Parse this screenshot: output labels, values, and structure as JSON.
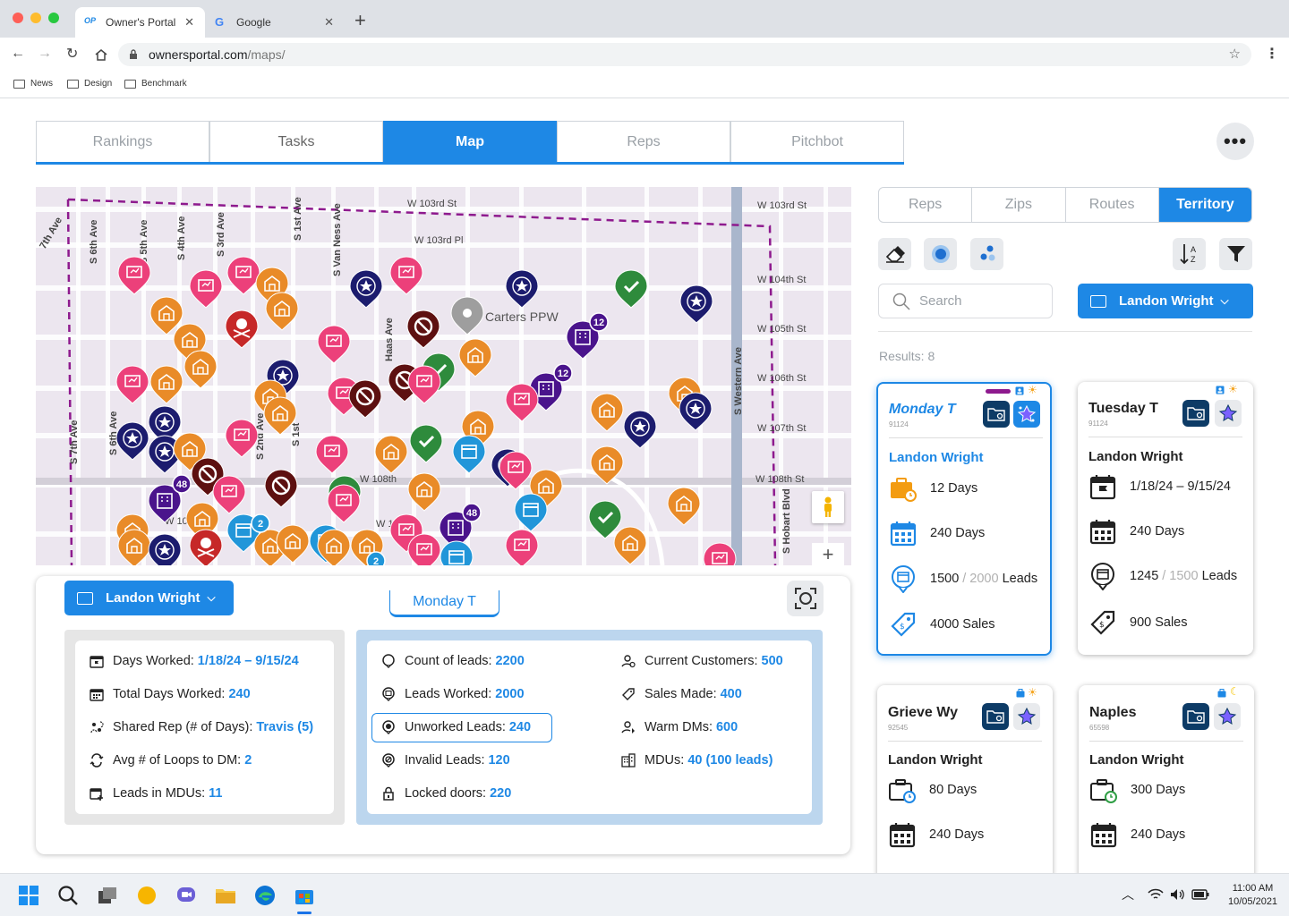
{
  "browser": {
    "tabs": [
      {
        "label": "Owner's Portal",
        "logo": "OP"
      },
      {
        "label": "Google",
        "logo": "G"
      }
    ],
    "url_domain": "ownersportal.com",
    "url_path": "/maps/",
    "bookmarks": [
      "News",
      "Design",
      "Benchmark"
    ]
  },
  "nav": {
    "tabs": [
      "Rankings",
      "Tasks",
      "Map",
      "Reps",
      "Pitchbot"
    ],
    "active": "Map"
  },
  "map": {
    "streets": [
      {
        "label": "W 103rd St"
      },
      {
        "label": "W 103rd Pl"
      },
      {
        "label": "W 103rd St"
      },
      {
        "label": "W 104th St"
      },
      {
        "label": "W 105th St"
      },
      {
        "label": "W 106th St"
      },
      {
        "label": "W 107th St"
      },
      {
        "label": "W 108th St"
      },
      {
        "label": "W 108th"
      },
      {
        "label": "W 109"
      },
      {
        "label": "W 109"
      },
      {
        "label": "S Van Ness Ave"
      },
      {
        "label": "S 1st Ave"
      },
      {
        "label": "S 3rd Ave"
      },
      {
        "label": "S 4th Ave"
      },
      {
        "label": "S 5th Ave"
      },
      {
        "label": "S 6th Ave"
      },
      {
        "label": "7th Ave"
      },
      {
        "label": "S Western Ave"
      },
      {
        "label": "Haas Ave"
      },
      {
        "label": "S Hobart Blvd"
      },
      {
        "label": "S 6th Ave"
      },
      {
        "label": "S 7th Ave"
      },
      {
        "label": "S 2nd Ave"
      },
      {
        "label": "S 1st"
      }
    ],
    "place_label": "Carters PPW",
    "cluster_counts": [
      "12",
      "12",
      "48",
      "48",
      "2",
      "2"
    ]
  },
  "bottom": {
    "rep_dropdown": "Landon Wright",
    "route_tab": "Monday T",
    "left_stats": [
      {
        "label": "Days Worked:",
        "value": "1/18/24 – 9/15/24",
        "icon": "calendar-flag-icon"
      },
      {
        "label": "Total Days Worked:",
        "value": "240",
        "icon": "calendar-icon"
      },
      {
        "label": "Shared Rep (# of Days):",
        "value": "Travis (5)",
        "icon": "shared-rep-icon"
      },
      {
        "label": "Avg # of Loops to DM:",
        "value": "2",
        "icon": "loop-icon"
      },
      {
        "label": "Leads in MDUs:",
        "value": "11",
        "icon": "calendar-add-icon"
      }
    ],
    "mid_stats_col1": [
      {
        "label": "Count of leads:",
        "value": "2200",
        "icon": "circle-icon"
      },
      {
        "label": "Leads Worked:",
        "value": "2000",
        "icon": "calendar-circle-icon"
      },
      {
        "label": "Unworked Leads:",
        "value": "240",
        "icon": "unworked-icon",
        "highlight": true
      },
      {
        "label": "Invalid Leads:",
        "value": "120",
        "icon": "invalid-icon"
      },
      {
        "label": "Locked doors:",
        "value": "220",
        "icon": "lock-icon"
      }
    ],
    "mid_stats_col2": [
      {
        "label": "Current Customers:",
        "value": "500",
        "icon": "customers-icon"
      },
      {
        "label": "Sales Made:",
        "value": "400",
        "icon": "tag-icon"
      },
      {
        "label": "Warm DMs:",
        "value": "600",
        "icon": "warm-dm-icon"
      },
      {
        "label": "MDUs:",
        "value": "40 (100 leads)",
        "icon": "building-icon"
      }
    ]
  },
  "right": {
    "segments": [
      "Reps",
      "Zips",
      "Routes",
      "Territory"
    ],
    "active_segment": "Territory",
    "search_placeholder": "Search",
    "rep_dropdown": "Landon Wright",
    "results": "Results: 8",
    "cards": [
      {
        "title": "Monday T",
        "zip": "91124",
        "rep": "Landon Wright",
        "row1": "12 Days",
        "row2": "240 Days",
        "leads_done": "1500",
        "leads_sep": "/",
        "leads_total": "2000",
        "leads_label": "Leads",
        "sales": "4000 Sales"
      },
      {
        "title": "Tuesday T",
        "zip": "91124",
        "rep": "Landon Wright",
        "row1": "1/18/24 – 9/15/24",
        "row2": "240 Days",
        "leads_done": "1245",
        "leads_sep": "/",
        "leads_total": "1500",
        "leads_label": "Leads",
        "sales": "900 Sales"
      },
      {
        "title": "Grieve Wy",
        "zip": "92545",
        "rep": "Landon Wright",
        "row1": "80 Days",
        "row2": "240 Days"
      },
      {
        "title": "Naples",
        "zip": "65598",
        "rep": "Landon Wright",
        "row1": "300 Days",
        "row2": "240 Days"
      }
    ],
    "colors": {
      "accent": "#1e88e5",
      "navy": "#0d3b66",
      "purple": "#8e1a8e"
    }
  },
  "taskbar": {
    "time": "11:00 AM",
    "date": "10/05/2021"
  }
}
